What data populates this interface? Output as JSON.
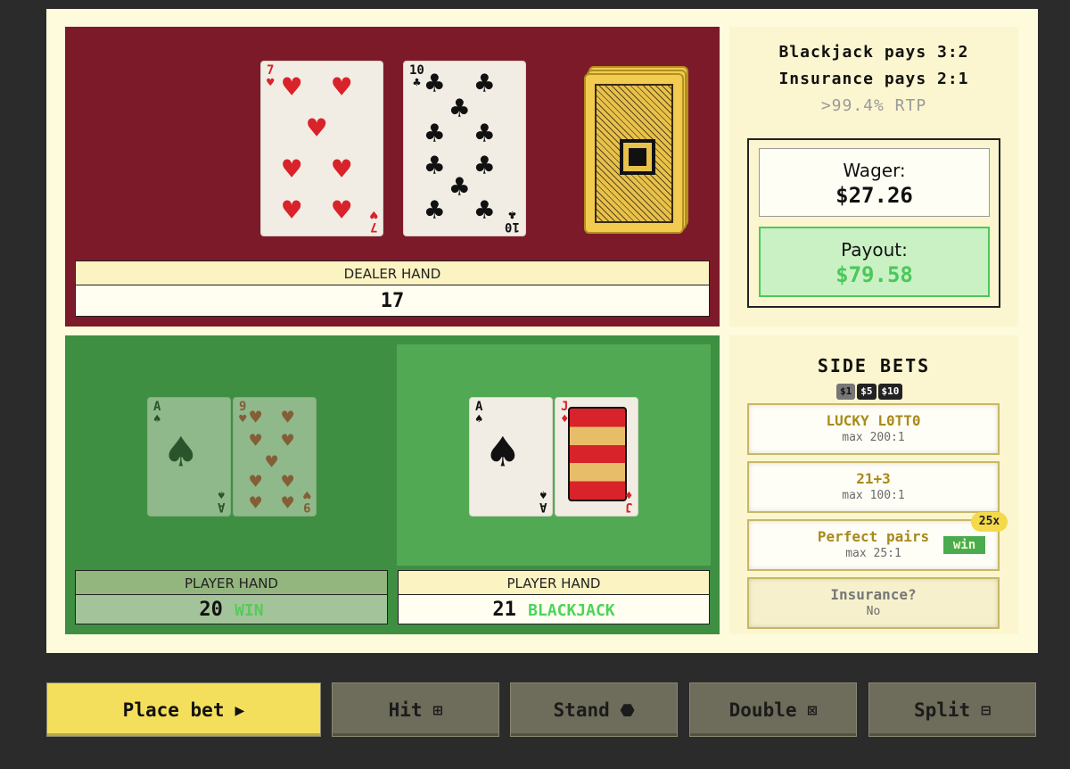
{
  "dealer": {
    "label": "DEALER HAND",
    "total": "17",
    "cards": [
      {
        "rank": "7",
        "suit": "♥",
        "color": "red"
      },
      {
        "rank": "10",
        "suit": "♣",
        "color": "black"
      }
    ]
  },
  "info": {
    "blackjack_pays": "Blackjack pays 3:2",
    "insurance_pays": "Insurance pays 2:1",
    "rtp": ">99.4% RTP"
  },
  "wager": {
    "label": "Wager:",
    "value": "$27.26"
  },
  "payout": {
    "label": "Payout:",
    "value": "$79.58"
  },
  "player_hands": [
    {
      "label": "PLAYER HAND",
      "total": "20",
      "result": "WIN",
      "active": false,
      "cards": [
        {
          "rank": "A",
          "suit": "♠",
          "color": "black"
        },
        {
          "rank": "9",
          "suit": "♥",
          "color": "red"
        }
      ]
    },
    {
      "label": "PLAYER HAND",
      "total": "21",
      "result": "BLACKJACK",
      "active": true,
      "cards": [
        {
          "rank": "A",
          "suit": "♠",
          "color": "black"
        },
        {
          "rank": "J",
          "suit": "♦",
          "color": "red"
        }
      ]
    }
  ],
  "side_bets": {
    "title": "SIDE BETS",
    "chips": [
      "$1",
      "$5",
      "$10"
    ],
    "selected_chip": "$1",
    "items": [
      {
        "name": "LUCKY L0TT0",
        "sub": "max 200:1"
      },
      {
        "name": "21+3",
        "sub": "max 100:1"
      },
      {
        "name": "Perfect pairs",
        "sub": "max 25:1",
        "multiplier": "25x",
        "status": "win"
      },
      {
        "name": "Insurance?",
        "sub": "No"
      }
    ]
  },
  "buttons": [
    {
      "label": "Place bet",
      "icon": "play-icon",
      "glyph": "▶"
    },
    {
      "label": "Hit",
      "icon": "plus-box-icon",
      "glyph": "⊞"
    },
    {
      "label": "Stand",
      "icon": "stop-octagon-icon",
      "glyph": "⬣"
    },
    {
      "label": "Double",
      "icon": "x-box-icon",
      "glyph": "⊠"
    },
    {
      "label": "Split",
      "icon": "divide-box-icon",
      "glyph": "⊟"
    }
  ],
  "colors": {
    "dealer_felt": "#7d1a2a",
    "player_felt": "#3f8f43",
    "accent_yellow": "#f4df5c",
    "win_green": "#4bc85a"
  }
}
